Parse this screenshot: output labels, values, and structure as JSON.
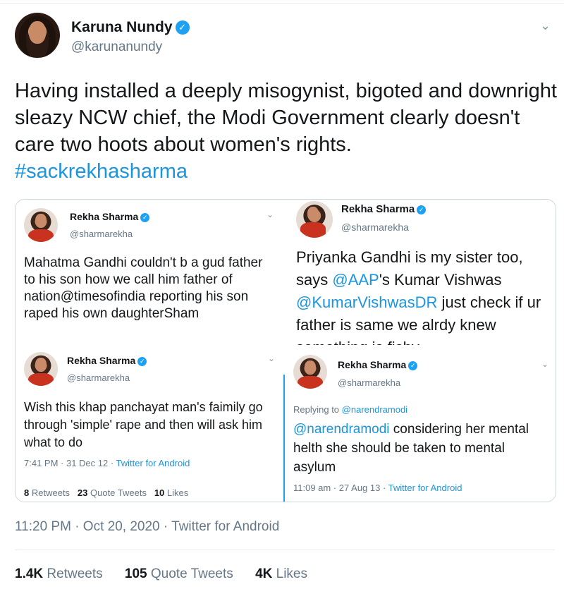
{
  "tweet": {
    "author_name": "Karuna Nundy",
    "handle": "@karunanundy",
    "text": "Having installed a deeply misogynist, bigoted and downright sleazy NCW chief, the Modi Government clearly doesn't care two hoots about women's rights.",
    "hashtag": "#sackrekhasharma",
    "timestamp": "11:20 PM · Oct 20, 2020 · ",
    "source": "Twitter for Android",
    "stats": {
      "retweets_count": "1.4K",
      "retweets_label": "Retweets",
      "quotes_count": "105",
      "quotes_label": "Quote Tweets",
      "likes_count": "4K",
      "likes_label": "Likes"
    }
  },
  "embedded": {
    "card1": {
      "name": "Rekha Sharma",
      "handle": "@sharmarekha",
      "text": "Mahatma Gandhi couldn't b a gud father to his son how we call him father of nation@timesofindia reporting his son raped his own daughterSham"
    },
    "card2": {
      "name": "Rekha Sharma",
      "handle": "@sharmarekha",
      "text_pre": "Priyanka Gandhi is my sister too, says ",
      "link1": "@AAP",
      "text_mid": "'s Kumar Vishwas ",
      "link2": "@KumarVishwasDR",
      "text_post": " just check if ur father is same we alrdy knew somethinq is fishv"
    },
    "card3": {
      "name": "Rekha Sharma",
      "handle": "@sharmarekha",
      "text": "Wish this khap panchayat man's faimily go through 'simple' rape and then will ask him what to do",
      "time": "7:41 PM · 31 Dec 12 · ",
      "source": "Twitter for Android",
      "retweets_count": "8",
      "retweets_label": "Retweets",
      "quotes_count": "23",
      "quotes_label": "Quote Tweets",
      "likes_count": "10",
      "likes_label": "Likes"
    },
    "card4": {
      "name": "Rekha Sharma",
      "handle": "@sharmarekha",
      "reply_prefix": "Replying to ",
      "reply_to": "@narendramodi",
      "mention": "@narendramodi",
      "text": " considering her mental helth she should be taken to mental asylum",
      "time": "11:09 am · 27 Aug 13 · ",
      "source": "Twitter for Android"
    }
  },
  "icons": {
    "verified": "✓",
    "caret": "⌄"
  }
}
